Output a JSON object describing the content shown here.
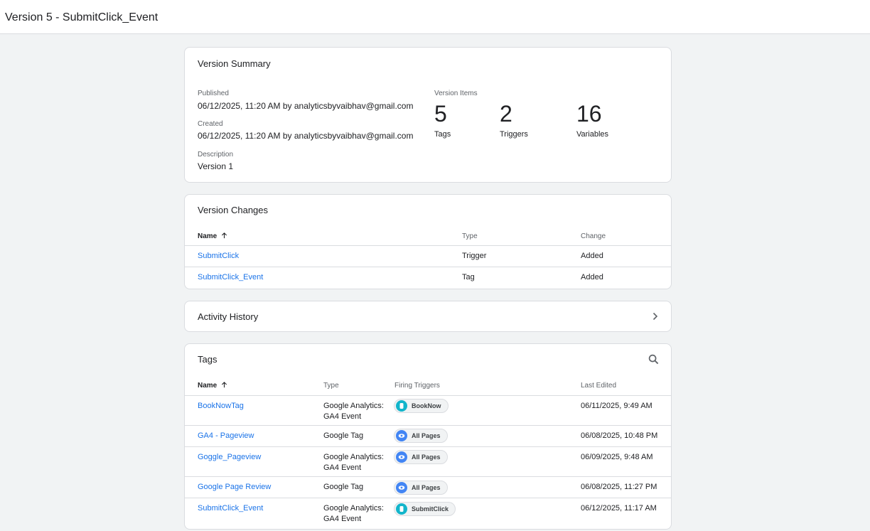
{
  "header": {
    "title": "Version 5 - SubmitClick_Event"
  },
  "summary": {
    "title": "Version Summary",
    "published_label": "Published",
    "published_value": "06/12/2025, 11:20 AM by analyticsbyvaibhav@gmail.com",
    "created_label": "Created",
    "created_value": "06/12/2025, 11:20 AM by analyticsbyvaibhav@gmail.com",
    "description_label": "Description",
    "description_value": "Version 1",
    "items_label": "Version Items",
    "items": [
      {
        "count": "5",
        "label": "Tags"
      },
      {
        "count": "2",
        "label": "Triggers"
      },
      {
        "count": "16",
        "label": "Variables"
      }
    ]
  },
  "changes": {
    "title": "Version Changes",
    "columns": {
      "name": "Name",
      "type": "Type",
      "change": "Change"
    },
    "rows": [
      {
        "name": "SubmitClick",
        "type": "Trigger",
        "change": "Added"
      },
      {
        "name": "SubmitClick_Event",
        "type": "Tag",
        "change": "Added"
      }
    ]
  },
  "activity": {
    "title": "Activity History",
    "icon": "chevron-right-icon"
  },
  "tags": {
    "title": "Tags",
    "search_icon": "search-icon",
    "columns": {
      "name": "Name",
      "type": "Type",
      "triggers": "Firing Triggers",
      "edited": "Last Edited"
    },
    "rows": [
      {
        "name": "BookNowTag",
        "type1": "Google Analytics:",
        "type2": "GA4 Event",
        "trigger": "BookNow",
        "trigger_kind": "click",
        "edited": "06/11/2025, 9:49 AM"
      },
      {
        "name": "GA4 - Pageview",
        "type1": "Google Tag",
        "type2": "",
        "trigger": "All Pages",
        "trigger_kind": "pageview",
        "edited": "06/08/2025, 10:48 PM"
      },
      {
        "name": "Goggle_Pageview",
        "type1": "Google Analytics:",
        "type2": "GA4 Event",
        "trigger": "All Pages",
        "trigger_kind": "pageview",
        "edited": "06/09/2025, 9:48 AM"
      },
      {
        "name": "Google Page Review",
        "type1": "Google Tag",
        "type2": "",
        "trigger": "All Pages",
        "trigger_kind": "pageview",
        "edited": "06/08/2025, 11:27 PM"
      },
      {
        "name": "SubmitClick_Event",
        "type1": "Google Analytics:",
        "type2": "GA4 Event",
        "trigger": "SubmitClick",
        "trigger_kind": "click",
        "edited": "06/12/2025, 11:17 AM"
      }
    ]
  },
  "colors": {
    "link": "#1a73e8",
    "click_trigger": "#12b5cb",
    "pageview_trigger": "#4285f4",
    "background": "#f1f3f4"
  }
}
